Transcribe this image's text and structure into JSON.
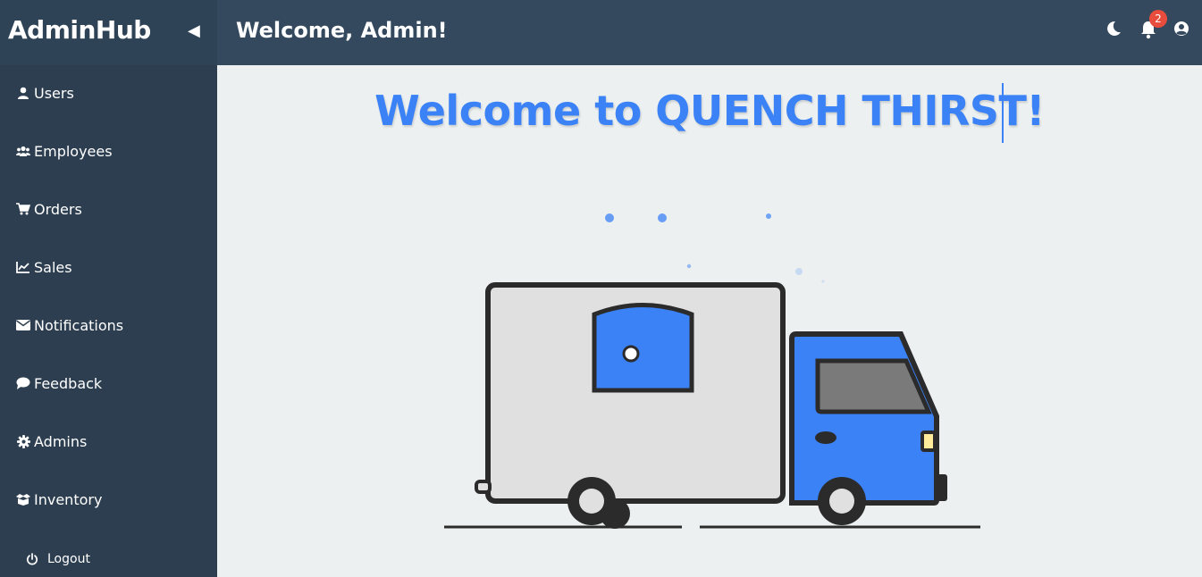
{
  "brand": "AdminHub",
  "header": {
    "collapse_glyph": "◀",
    "welcome": "Welcome, Admin!",
    "notification_count": "2",
    "icons": [
      "moon-icon",
      "bell-icon",
      "user-circle-icon"
    ]
  },
  "sidebar": {
    "items": [
      {
        "label": "Users",
        "icon": "user-icon"
      },
      {
        "label": "Employees",
        "icon": "users-group-icon"
      },
      {
        "label": "Orders",
        "icon": "cart-icon"
      },
      {
        "label": "Sales",
        "icon": "chart-line-icon"
      },
      {
        "label": "Notifications",
        "icon": "envelope-icon"
      },
      {
        "label": "Feedback",
        "icon": "comment-icon"
      },
      {
        "label": "Admins",
        "icon": "gear-icon"
      },
      {
        "label": "Inventory",
        "icon": "box-open-icon"
      }
    ],
    "logout": {
      "label": "Logout",
      "icon": "power-icon"
    }
  },
  "main": {
    "title": "Welcome to QUENCH THIRST!"
  },
  "colors": {
    "accent": "#3b82f6",
    "topbar": "#34495e",
    "sidebar": "#2c3e50",
    "background": "#ecf0f1",
    "badge": "#e74c3c"
  }
}
